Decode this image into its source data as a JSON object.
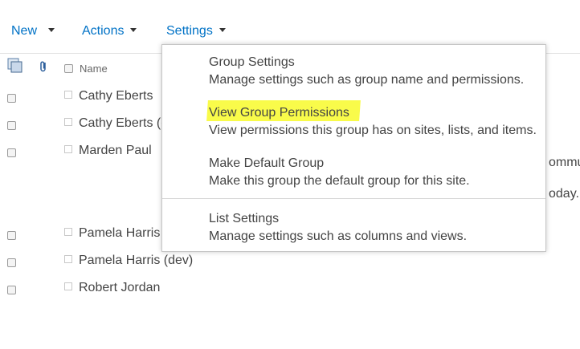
{
  "toolbar": {
    "new_label": "New",
    "actions_label": "Actions",
    "settings_label": "Settings"
  },
  "list": {
    "header": {
      "name_label": "Name"
    },
    "rows": [
      {
        "name": "Cathy Eberts"
      },
      {
        "name": "Cathy Eberts (d"
      },
      {
        "name": "Marden Paul"
      },
      {
        "name": "Pamela Harris"
      },
      {
        "name": "Pamela Harris (dev)"
      },
      {
        "name": "Robert Jordan"
      }
    ],
    "clipped_right_1": "ommu",
    "clipped_right_2": "oday."
  },
  "settings_menu": {
    "items": [
      {
        "title": "Group Settings",
        "description": "Manage settings such as group name and permissions."
      },
      {
        "title": "View Group Permissions",
        "description": "View permissions this group has on sites, lists, and items.",
        "highlighted": true
      },
      {
        "title": "Make Default Group",
        "description": "Make this group the default group for this site."
      },
      {
        "title": "List Settings",
        "description": "Manage settings such as columns and views."
      }
    ]
  },
  "colors": {
    "link_blue": "#0072c6",
    "highlight_yellow": "#f8fa2a",
    "text_gray": "#444444"
  }
}
